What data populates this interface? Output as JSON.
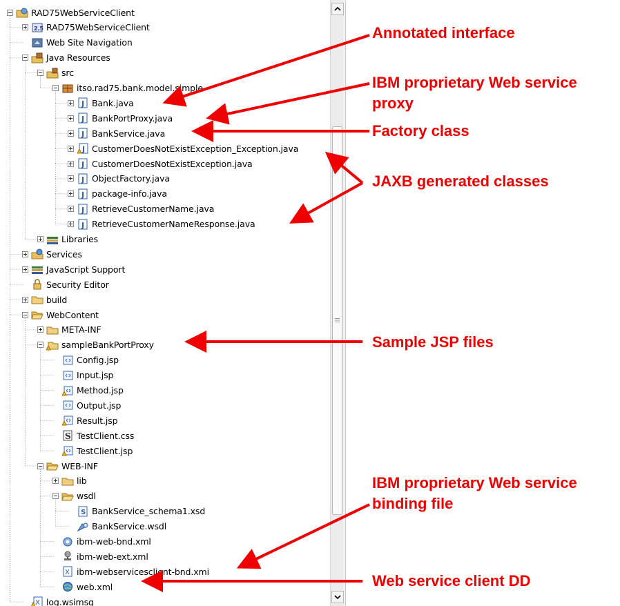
{
  "tree": {
    "items": [
      {
        "label": "RAD75WebServiceClient",
        "icon": "web-project-icon",
        "toggle": "minus",
        "name": "tree-item-rad75webserviceclient-project"
      },
      {
        "label": "RAD75WebServiceClient",
        "icon": "deployment-descriptor-icon",
        "toggle": "plus",
        "name": "tree-item-rad75webserviceclient-descriptor"
      },
      {
        "label": "Web Site Navigation",
        "icon": "web-site-navigation-icon",
        "toggle": "none",
        "name": "tree-item-web-site-navigation"
      },
      {
        "label": "Java Resources",
        "icon": "java-resources-icon",
        "toggle": "minus",
        "name": "tree-item-java-resources"
      },
      {
        "label": "src",
        "icon": "source-folder-icon",
        "toggle": "minus",
        "name": "tree-item-src"
      },
      {
        "label": "itso.rad75.bank.model.simple",
        "icon": "java-package-icon",
        "toggle": "minus",
        "name": "tree-item-package"
      },
      {
        "label": "Bank.java",
        "icon": "java-file-icon",
        "toggle": "plus",
        "name": "tree-item-bank-java"
      },
      {
        "label": "BankPortProxy.java",
        "icon": "java-file-icon",
        "toggle": "plus",
        "name": "tree-item-bankportproxy-java"
      },
      {
        "label": "BankService.java",
        "icon": "java-file-icon",
        "toggle": "plus",
        "name": "tree-item-bankservice-java"
      },
      {
        "label": "CustomerDoesNotExistException_Exception.java",
        "icon": "java-file-warning-icon",
        "toggle": "plus",
        "name": "tree-item-customerdoesnotexistexception-exception-java"
      },
      {
        "label": "CustomerDoesNotExistException.java",
        "icon": "java-file-icon",
        "toggle": "plus",
        "name": "tree-item-customerdoesnotexistexception-java"
      },
      {
        "label": "ObjectFactory.java",
        "icon": "java-file-icon",
        "toggle": "plus",
        "name": "tree-item-objectfactory-java"
      },
      {
        "label": "package-info.java",
        "icon": "java-file-icon",
        "toggle": "plus",
        "name": "tree-item-package-info-java"
      },
      {
        "label": "RetrieveCustomerName.java",
        "icon": "java-file-icon",
        "toggle": "plus",
        "name": "tree-item-retrievecustomername-java"
      },
      {
        "label": "RetrieveCustomerNameResponse.java",
        "icon": "java-file-icon",
        "toggle": "plus",
        "name": "tree-item-retrievecustomernameresponse-java"
      },
      {
        "label": "Libraries",
        "icon": "libraries-icon",
        "toggle": "plus",
        "name": "tree-item-libraries"
      },
      {
        "label": "Services",
        "icon": "services-icon",
        "toggle": "plus",
        "name": "tree-item-services"
      },
      {
        "label": "JavaScript Support",
        "icon": "javascript-support-icon",
        "toggle": "plus",
        "name": "tree-item-javascript-support"
      },
      {
        "label": "Security Editor",
        "icon": "security-editor-icon",
        "toggle": "none",
        "name": "tree-item-security-editor"
      },
      {
        "label": "build",
        "icon": "folder-icon",
        "toggle": "plus",
        "name": "tree-item-build"
      },
      {
        "label": "WebContent",
        "icon": "folder-open-icon",
        "toggle": "minus",
        "name": "tree-item-webcontent"
      },
      {
        "label": "META-INF",
        "icon": "folder-icon",
        "toggle": "plus",
        "name": "tree-item-meta-inf"
      },
      {
        "label": "sampleBankPortProxy",
        "icon": "folder-warning-icon",
        "toggle": "minus",
        "name": "tree-item-samplebankportproxy"
      },
      {
        "label": "Config.jsp",
        "icon": "jsp-file-icon",
        "toggle": "none",
        "name": "tree-item-config-jsp"
      },
      {
        "label": "Input.jsp",
        "icon": "jsp-file-icon",
        "toggle": "none",
        "name": "tree-item-input-jsp"
      },
      {
        "label": "Method.jsp",
        "icon": "jsp-file-warning-icon",
        "toggle": "none",
        "name": "tree-item-method-jsp"
      },
      {
        "label": "Output.jsp",
        "icon": "jsp-file-icon",
        "toggle": "none",
        "name": "tree-item-output-jsp"
      },
      {
        "label": "Result.jsp",
        "icon": "jsp-file-warning-icon",
        "toggle": "none",
        "name": "tree-item-result-jsp"
      },
      {
        "label": "TestClient.css",
        "icon": "css-file-icon",
        "toggle": "none",
        "name": "tree-item-testclient-css"
      },
      {
        "label": "TestClient.jsp",
        "icon": "jsp-file-warning-icon",
        "toggle": "none",
        "name": "tree-item-testclient-jsp"
      },
      {
        "label": "WEB-INF",
        "icon": "folder-open-icon",
        "toggle": "minus",
        "name": "tree-item-web-inf"
      },
      {
        "label": "lib",
        "icon": "folder-icon",
        "toggle": "plus",
        "name": "tree-item-lib"
      },
      {
        "label": "wsdl",
        "icon": "folder-open-icon",
        "toggle": "minus",
        "name": "tree-item-wsdl"
      },
      {
        "label": "BankService_schema1.xsd",
        "icon": "xsd-file-icon",
        "toggle": "none",
        "name": "tree-item-bankservice-schema1-xsd"
      },
      {
        "label": "BankService.wsdl",
        "icon": "wsdl-file-icon",
        "toggle": "none",
        "name": "tree-item-bankservice-wsdl"
      },
      {
        "label": "ibm-web-bnd.xml",
        "icon": "binding-file-icon",
        "toggle": "none",
        "name": "tree-item-ibm-web-bnd-xml"
      },
      {
        "label": "ibm-web-ext.xml",
        "icon": "extension-file-icon",
        "toggle": "none",
        "name": "tree-item-ibm-web-ext-xml"
      },
      {
        "label": "ibm-webservicesclient-bnd.xmi",
        "icon": "xmi-file-icon",
        "toggle": "none",
        "name": "tree-item-ibm-webservicesclient-bnd-xmi"
      },
      {
        "label": "web.xml",
        "icon": "web-xml-icon",
        "toggle": "none",
        "name": "tree-item-web-xml"
      },
      {
        "label": "log.wsimsg",
        "icon": "wsimsg-file-icon",
        "toggle": "none",
        "name": "tree-item-log-wsimsg"
      }
    ]
  },
  "callouts": {
    "annotated_interface": "Annotated interface",
    "ibm_proxy_line1": "IBM proprietary Web service",
    "ibm_proxy_line2": "proxy",
    "factory_class": "Factory class",
    "jaxb_generated": "JAXB generated classes",
    "sample_jsp": "Sample JSP files",
    "ibm_binding_line1": "IBM proprietary Web service",
    "ibm_binding_line2": "binding file",
    "client_dd": "Web service client DD"
  },
  "colors": {
    "callout_red": "#ee0000",
    "folder_yellow": "#e8c060",
    "java_blue": "#3060b0",
    "tree_line": "#a0a0a0"
  }
}
